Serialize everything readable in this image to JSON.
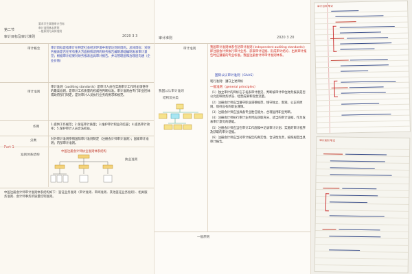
{
  "page1": {
    "header": {
      "line1": "第二节",
      "title": "审计目标及审计准则",
      "notes": [
        "要求学生掌握审计目标",
        "审计准则基本原则",
        "一般原则与具体准则"
      ],
      "date": "2020 3 3"
    },
    "rows": [
      {
        "label": "审计概念",
        "text": "审计目标是指审计在特定社会经济环境中希望达到的目的。总体目标：对财务报表是否在所有重大方面按照适用的财务报告编制基础编制发表审计意见；根据审计结果对财务报表出具审计报告，并与管理层和治理层沟通（企业价值）"
      },
      {
        "label": "审计准则",
        "text": "审计准则（auditing standards）是审计人员在实施审计工作时必须恪守的最高准则，是审计工作质量的权威性判断标准。审计准则由专门职业团体或政府部门制定，是对审计人员执行业务的要求和规范。"
      },
      {
        "label": "作用",
        "text": "1.提供工作规范；2.保证审计质量；3.维护审计职业的信誉；4.提高审计效率；5.保护审计人员合法权益。"
      },
      {
        "label": "分类",
        "text": "对外审计准则参照国际审计准则制定（注册会计师审计准则）；国家审计准则；内部审计准则。"
      }
    ],
    "part_label": "Part 1",
    "flowchart": {
      "title": "中国注册会计师执业准则体系结构",
      "side_label": "执业准则"
    },
    "flow_label": "准则体系结构",
    "footer": "中国注册会计师审计准则体系结构如下：鉴证业务准则（审计准则、审阅准则、其他鉴证业务准则）、相关服务准则、会计师事务所质量控制准则。"
  },
  "page2": {
    "header": {
      "title": "审计准则",
      "date": "2020 3 20"
    },
    "intro_label": "审计准则",
    "intro": "我国审计准则体系包括审计准则 (independent auditing standards)：即注册会计师执行审计业务、获取审计证据、形成审计结论、出具审计报告时应遵循的专业标准。我国注册会计师审计准则体系。",
    "side_label": "结构及分类",
    "section_title": "国际公认审计准则（GAAS）",
    "gaas_label": "我国公认审计准则",
    "sub_note": "现行准则：遵守上述目标",
    "items": [
      "一般准则（general principles）",
      "（1）独立审计的目标在于发表审计意见，判断被审计单位财务报表是否公允反映财务状况、经营成果和现金流量。",
      "（2）注册会计师应当遵守职业道德规范，恪守独立、客观、公正的原则，保持应有的职业谨慎。",
      "（3）注册会计师应当具备专业胜任能力，合理运用职业判断。",
      "（4）注册会计师执行审计业务时应获取充分、适当的审计证据，作为发表审计意见的基础。",
      "（5）注册会计师应当在审计工作底稿中记录审计计划、实施的审计程序及获取的审计证据。",
      "（6）注册会计师应当对审计报告的真实性、合法性负责，按照规定出具审计报告。"
    ],
    "footer_label": "一般原则"
  },
  "page3": {
    "note_top_title": "审计目标 笔记",
    "note_bottom_title": "审计准则 笔记"
  }
}
